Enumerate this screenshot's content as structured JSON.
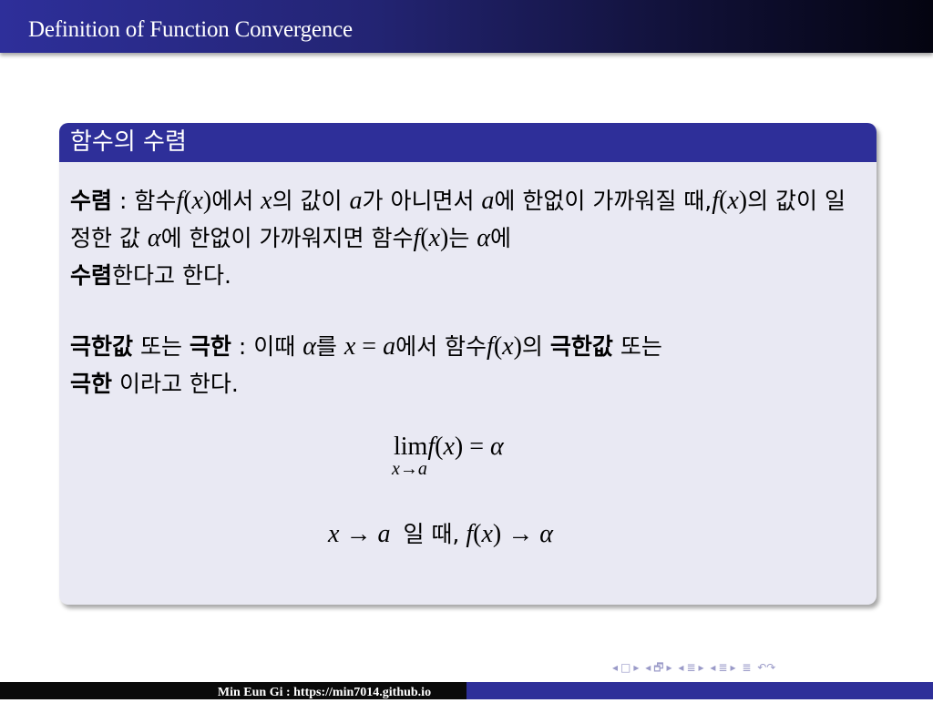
{
  "frame": {
    "title": "Definition of Function Convergence"
  },
  "block": {
    "title": "함수의 수렴",
    "def1": {
      "term": "수렴",
      "t1": " : 함수",
      "m_fx": "f",
      "p_open": "(",
      "m_x": "x",
      "p_close": ")",
      "t2": "에서 ",
      "t3": "의 값이 ",
      "m_a": "a",
      "t4": "가 아니면서 ",
      "t5": "에 한없이 가까워질 때,",
      "t6": "의 값이 일정한 값 ",
      "m_alpha": "α",
      "t7": "에 한없이 가까워지면 함수",
      "t8": "는 ",
      "t9": "에",
      "term_end": "수렴",
      "t10": "한다고 한다."
    },
    "def2": {
      "term_a": "극한값",
      "t1": " 또는 ",
      "term_b": "극한",
      "t2": " : 이때 ",
      "t3": "를 ",
      "eq": " = ",
      "t4": "에서 함수",
      "t5": "의 ",
      "t6": " 또는",
      "t7": " 이라고 한다."
    },
    "eq1": {
      "lim": "lim",
      "sub": "x→a",
      "rhs": " = "
    },
    "eq2": {
      "arrow": " → ",
      "text": "일 때,"
    }
  },
  "nav": {
    "symbols": [
      "◂",
      "□",
      "▸",
      "◂",
      "🗗",
      "▸",
      "◂",
      "≣",
      "▸",
      "◂",
      "≣",
      "▸",
      "≣",
      "↶↷"
    ]
  },
  "footer": {
    "text": "Min Eun Gi : https://min7014.github.io"
  },
  "colors": {
    "title_bar": "#2e2f9a",
    "block_title": "#2e2f99",
    "block_body": "#e9e9f3",
    "footer_left": "#0a0a0a",
    "footer_right": "#2e2f99"
  }
}
